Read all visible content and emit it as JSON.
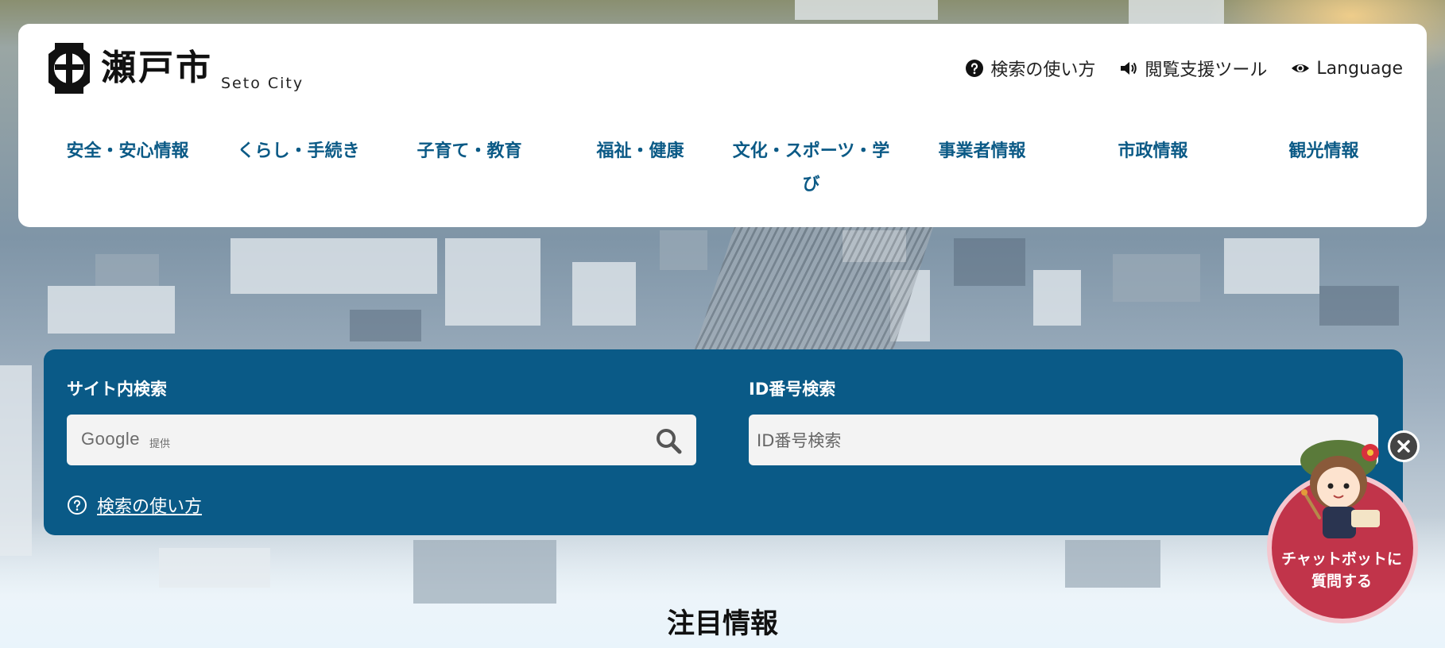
{
  "header": {
    "logo_text": "瀬戸市",
    "logo_sub": "Seto City",
    "utility": [
      {
        "label": "検索の使い方",
        "icon": "question-icon"
      },
      {
        "label": "閲覧支援ツール",
        "icon": "speaker-icon"
      },
      {
        "label": "Language",
        "icon": "eye-icon"
      }
    ]
  },
  "nav": {
    "items": [
      "安全・安心情報",
      "くらし・手続き",
      "子育て・教育",
      "福祉・健康",
      "文化・スポーツ・学び",
      "事業者情報",
      "市政情報",
      "観光情報"
    ]
  },
  "search": {
    "site_label": "サイト内検索",
    "google_logo": "Google",
    "google_tag": "提供",
    "id_label": "ID番号検索",
    "id_placeholder": "ID番号検索",
    "help_link": "検索の使い方"
  },
  "featured": {
    "heading": "注目情報"
  },
  "chatbot": {
    "text": "チャットボットに\n質問する"
  },
  "colors": {
    "brand_blue": "#0a5a87",
    "nav_text": "#0b5a86",
    "chatbot_red": "#c1344a"
  }
}
